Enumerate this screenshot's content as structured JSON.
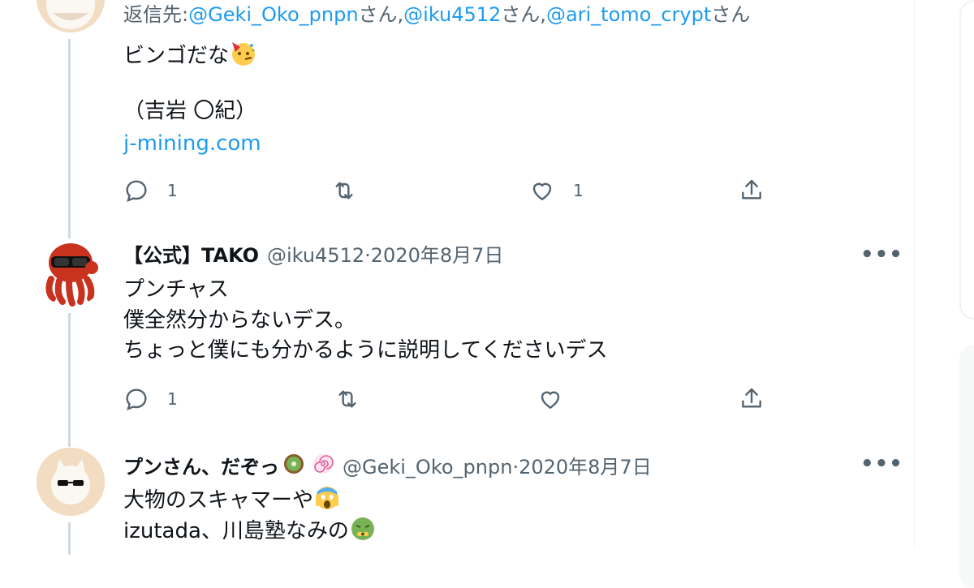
{
  "tweet1": {
    "reply_prefix": "返信先: ",
    "mention1": "@Geki_Oko_pnpn",
    "san1": "さん, ",
    "mention2": "@iku4512",
    "san2": "さん, ",
    "mention3": "@ari_tomo_crypt",
    "san3": "さん",
    "line1": "ビンゴだな",
    "line1_emoji": "partying-face-emoji",
    "line2": "（吉岩 〇紀）",
    "link": "j-mining.com",
    "reply_count": "1",
    "like_count": "1"
  },
  "tweet2": {
    "display_name": "【公式】TAKO",
    "handle": "@iku4512",
    "separator": " · ",
    "date": "2020年8月7日",
    "lines": [
      "プンチャス",
      "僕全然分からないデス。",
      "ちょっと僕にも分かるように説明してくださいデス"
    ],
    "reply_count": "1",
    "avatar_icon": "octopus-avatar"
  },
  "tweet3": {
    "display_name": "プンさん、だぞっ",
    "name_emojis": [
      "kiwi-emoji",
      "spiral-candy-emoji"
    ],
    "handle": "@Geki_Oko_pnpn",
    "separator": " · ",
    "date": "2020年8月7日",
    "line1": "大物のスキャマーや",
    "line1_emoji": "screaming-face-emoji",
    "line2": "izutada、川島塾なみの",
    "line2_emoji": "nauseated-face-emoji",
    "avatar_icon": "cat-sunglasses-avatar"
  },
  "more_label": "•••",
  "colors": {
    "link": "#1d9bf0",
    "muted": "#536471",
    "thread_line": "#cfd9de"
  }
}
